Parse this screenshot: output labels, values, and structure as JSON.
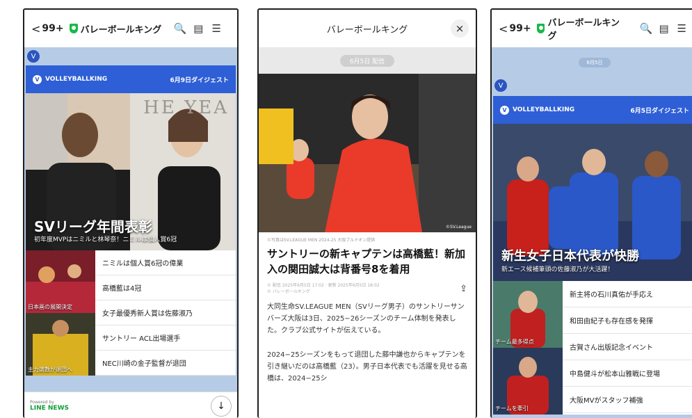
{
  "common": {
    "back": "<",
    "count": "99+",
    "account": "バレーボールキング",
    "search_icon": "🔍",
    "list_icon": "▤",
    "menu_icon": "☰"
  },
  "left": {
    "channel_badge": "V",
    "card_logo": "VOLLEYBALLKING",
    "card_date": "6月9日ダイジェスト",
    "hero_bg_text": "HE YEA",
    "hero_title": "SVリーグ年間表彰",
    "hero_sub": "初年度MVPはニミルと林琴奈！ニミルは個人賞6冠",
    "thumb1_cap": "日本画の展開決定",
    "thumb2_cap": "主力選数が退団へ",
    "items": [
      "ニミルは個人賞6冠の偉業",
      "高橋藍は4冠",
      "女子最優秀新人賞は佐藤淑乃",
      "サントリー ACL出場選手",
      "NEC川崎の金子監督が退団"
    ],
    "powered": "Powered by",
    "line_news": "LINE NEWS",
    "down_icon": "↓"
  },
  "middle": {
    "title": "バレーボールキング",
    "close": "×",
    "date_pill": "6月5日 配信",
    "photo_credit": "©SV.League",
    "caption": "©写真はSV.LEAGUE MEN 2024-25 大阪ブルテオン提供",
    "headline": "サントリーの新キャプテンは高橋藍！新加入の関田誠大は背番号8を着用",
    "meta": "© 配信 2025年6月5日 17:02 · 更新 2025年6月5日 18:02\n© バレーボールキング",
    "share": "⇪",
    "para1": "大同生命SV.LEAGUE MEN（SVリーグ男子）のサントリーサンバーズ大阪は3日、2025−26シーズンのチーム体制を発表した。クラブ公式サイトが伝えている。",
    "para2": "2024−25シーズンをもって退団した藤中謙也からキャプテンを引き継いだのは高橋藍（23）。男子日本代表でも活躍を見せる高橋は、2024−25シ"
  },
  "right": {
    "date_pill": "6月5日",
    "channel_badge": "V",
    "card_logo": "VOLLEYBALLKING",
    "card_date": "6月5日ダイジェスト",
    "hero_title": "新生女子日本代表が快勝",
    "hero_sub": "新エース候補筆頭の佐藤淑乃が大活躍！",
    "thumb1_cap": "チーム最多得点",
    "thumb2_cap": "チームを牽引",
    "items": [
      "新主将の石川真佑が手応え",
      "和田由紀子も存在感を発揮",
      "古賀さん出版記念イベント",
      "中島健斗が松本山雅戦に登場",
      "大阪MVがスタッフ補強"
    ]
  }
}
